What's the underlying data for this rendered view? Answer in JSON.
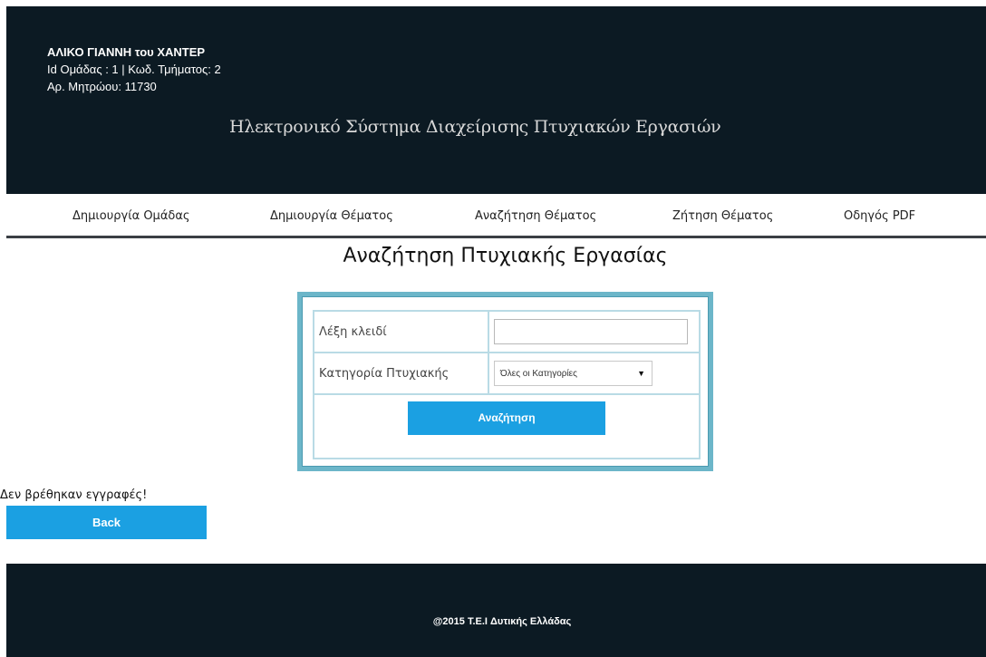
{
  "header": {
    "user_name": "ΑΛΙΚΟ ΓΙΑΝΝΗ του ΧΑΝΤΕΡ",
    "group_info": "Id Ομάδας : 1 | Κωδ. Τμήματος: 2",
    "registry_number": "Αρ. Μητρώου: 11730",
    "system_title": "Ηλεκτρονικό Σύστημα Διαχείρισης Πτυχιακών Εργασιών"
  },
  "nav": {
    "items": [
      {
        "label": "Δημιουργία Ομάδας"
      },
      {
        "label": "Δημιουργία Θέματος"
      },
      {
        "label": "Αναζήτηση Θέματος"
      },
      {
        "label": "Ζήτηση Θέματος"
      },
      {
        "label": "Οδηγός PDF"
      }
    ]
  },
  "main": {
    "title": "Αναζήτηση Πτυχιακής Εργασίας",
    "search_form": {
      "keyword_label": "Λέξη κλειδί",
      "keyword_value": "",
      "category_label": "Κατηγορία Πτυχιακής",
      "category_selected": "Όλες οι Κατηγορίες",
      "submit_label": "Αναζήτηση"
    },
    "no_records_message": "Δεν βρέθηκαν εγγραφές!",
    "back_label": "Back"
  },
  "footer": {
    "copyright": "@2015 T.E.I Δυτικής Ελλάδας"
  },
  "colors": {
    "header_bg": "#0c1a23",
    "accent": "#1ba0e2",
    "form_border": "#6cb6c9"
  },
  "icons": {
    "select_caret": "caret-down-icon"
  }
}
